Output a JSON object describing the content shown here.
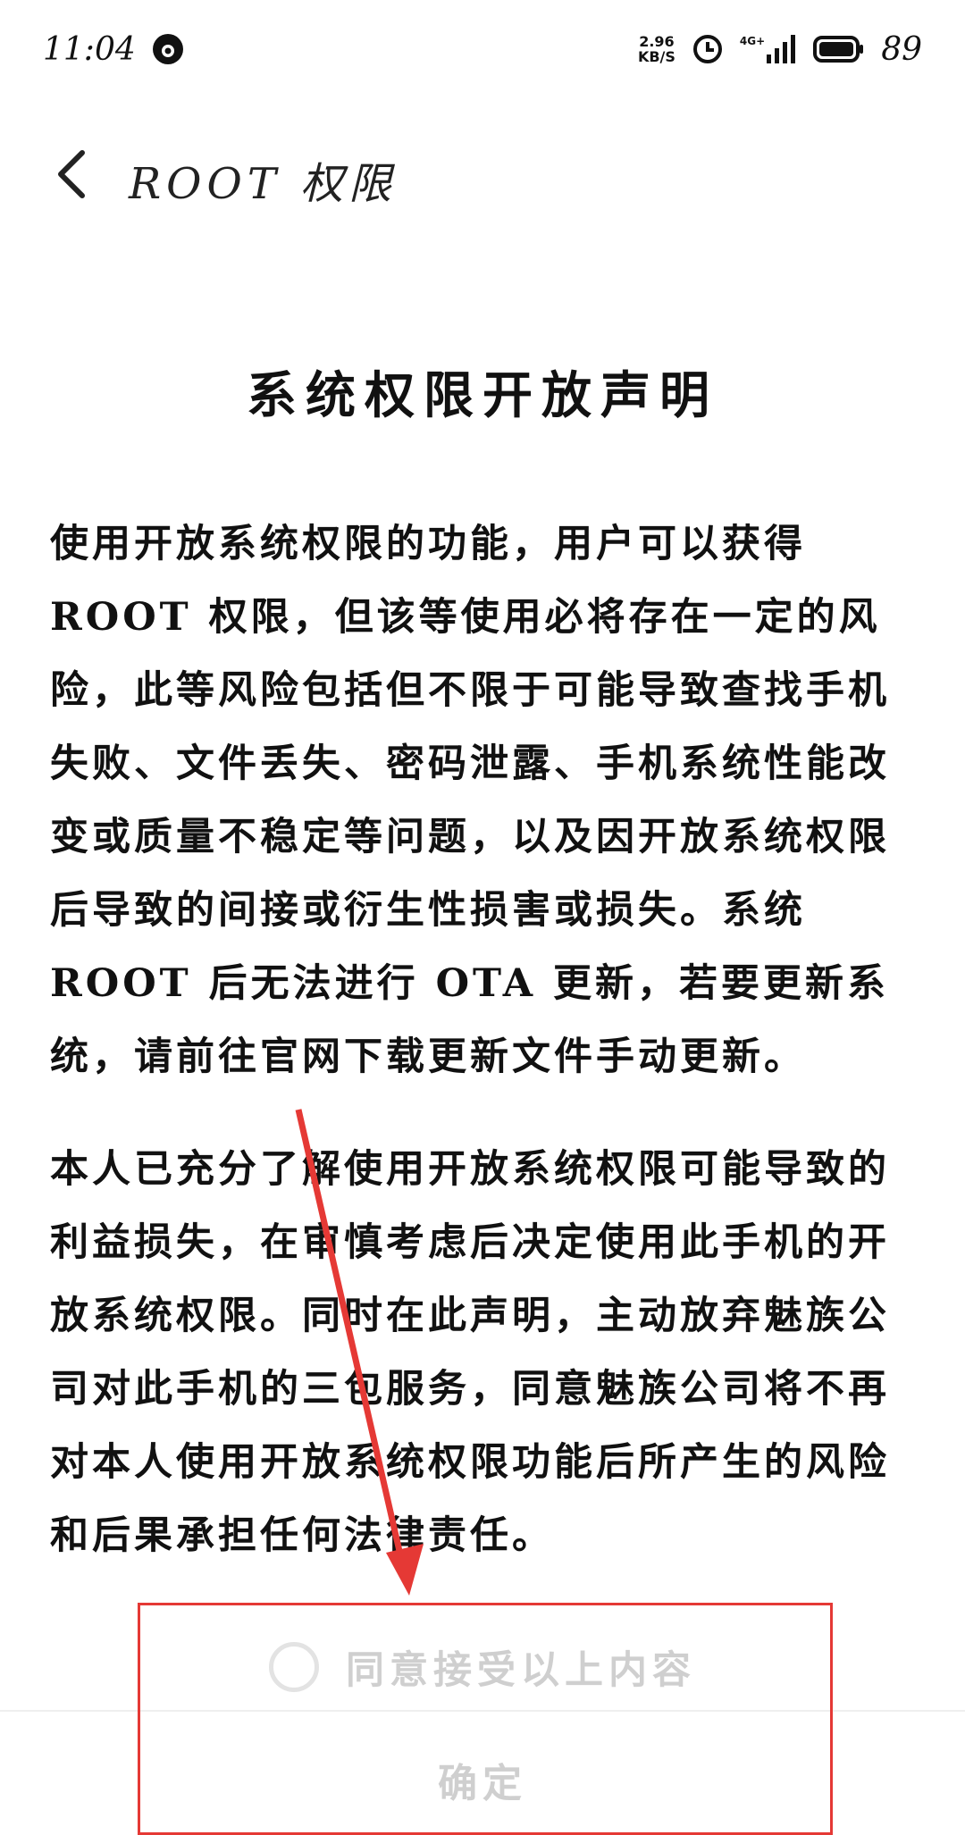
{
  "status_bar": {
    "time": "11:04",
    "speed_value": "2.96",
    "speed_unit": "KB/S",
    "network": "4G+",
    "battery": "89"
  },
  "header": {
    "title": "ROOT 权限"
  },
  "document": {
    "title": "系统权限开放声明",
    "paragraph1": "使用开放系统权限的功能，用户可以获得ROOT 权限，但该等使用必将存在一定的风险，此等风险包括但不限于可能导致查找手机失败、文件丢失、密码泄露、手机系统性能改变或质量不稳定等问题，以及因开放系统权限后导致的间接或衍生性损害或损失。系统 ROOT 后无法进行 OTA 更新，若要更新系统，请前往官网下载更新文件手动更新。",
    "paragraph2": "本人已充分了解使用开放系统权限可能导致的利益损失，在审慎考虑后决定使用此手机的开放系统权限。同时在此声明，主动放弃魅族公司对此手机的三包服务，同意魅族公司将不再对本人使用开放系统权限功能后所产生的风险和后果承担任何法律责任。"
  },
  "agreement": {
    "label": "同意接受以上内容",
    "checked": false
  },
  "confirm_button": {
    "label": "确定"
  },
  "colors": {
    "highlight": "#e53935",
    "disabled_text": "#cfcfcf"
  }
}
